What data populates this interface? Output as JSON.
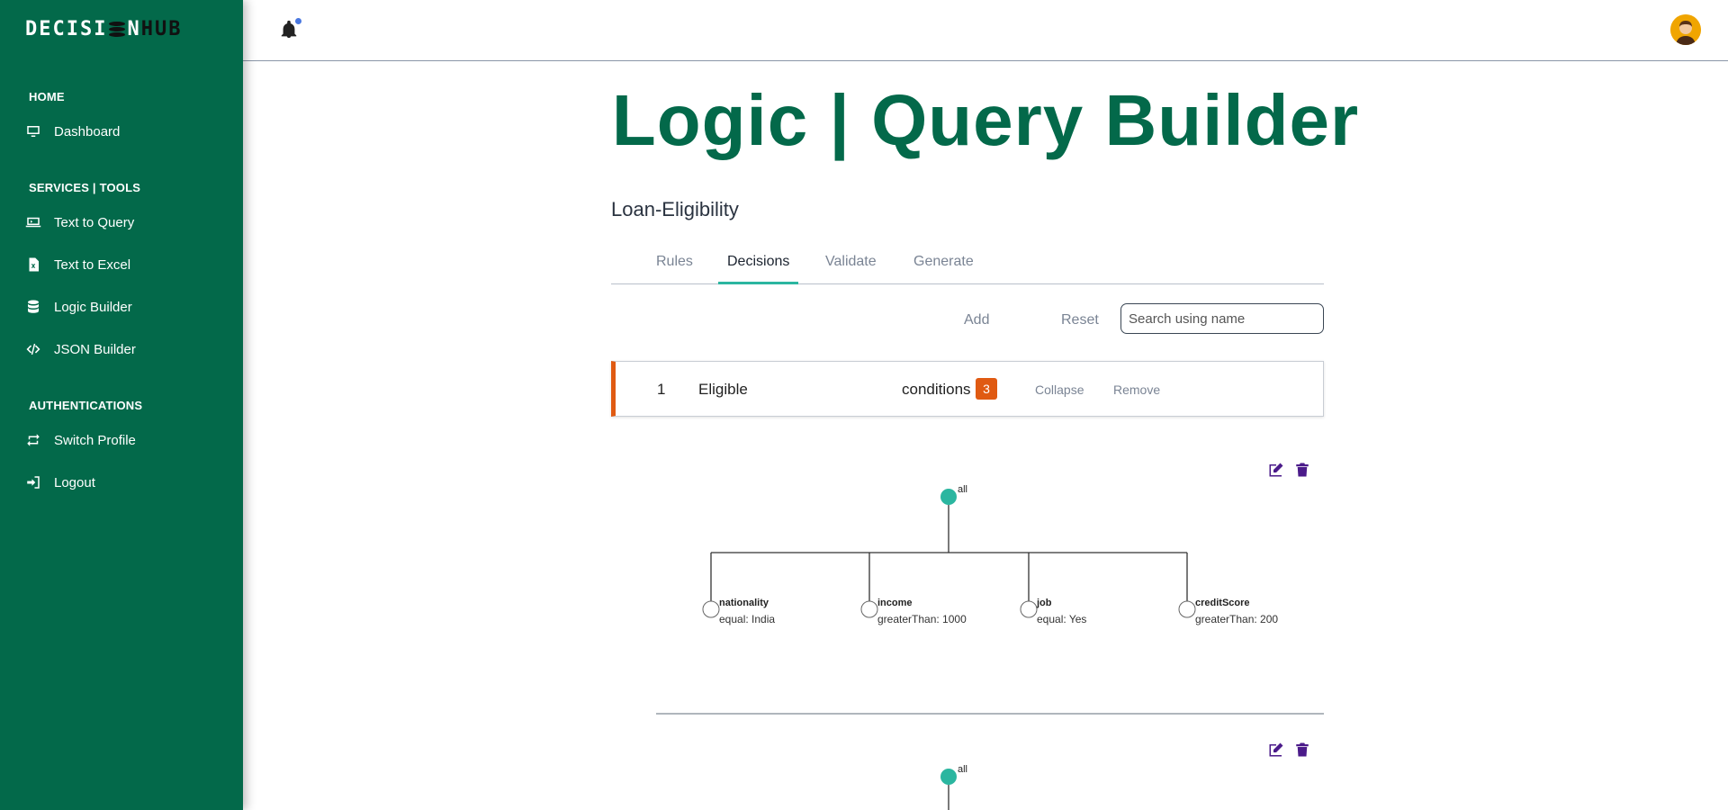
{
  "brand": {
    "name_part1": "DECISI",
    "name_part2": "N",
    "name_part3": "HUB"
  },
  "sidebar": {
    "sections": [
      {
        "title": "HOME"
      },
      {
        "title": "SERVICES | TOOLS"
      },
      {
        "title": "AUTHENTICATIONS"
      }
    ],
    "items": [
      {
        "label": "Dashboard",
        "icon": "monitor-icon"
      },
      {
        "label": "Text to Query",
        "icon": "terminal-icon"
      },
      {
        "label": "Text to Excel",
        "icon": "excel-file-icon"
      },
      {
        "label": "Logic Builder",
        "icon": "database-icon"
      },
      {
        "label": "JSON Builder",
        "icon": "code-icon"
      },
      {
        "label": "Switch Profile",
        "icon": "switch-icon"
      },
      {
        "label": "Logout",
        "icon": "logout-icon"
      }
    ]
  },
  "header": {
    "notification_icon": "bell-icon",
    "has_notification": true
  },
  "page": {
    "title": "Logic | Query Builder",
    "rule_name": "Loan-Eligibility",
    "tabs": [
      {
        "label": "Rules",
        "active": false
      },
      {
        "label": "Decisions",
        "active": true
      },
      {
        "label": "Validate",
        "active": false
      },
      {
        "label": "Generate",
        "active": false
      }
    ],
    "actions": {
      "add_label": "Add",
      "reset_label": "Reset",
      "search_placeholder": "Search using name"
    }
  },
  "decision": {
    "index": "1",
    "name": "Eligible",
    "conditions_label": "conditions",
    "conditions_count": "3",
    "collapse_label": "Collapse",
    "remove_label": "Remove"
  },
  "trees": [
    {
      "root": "all",
      "children": [
        {
          "fact": "nationality",
          "condition": "equal: India"
        },
        {
          "fact": "income",
          "condition": "greaterThan: 1000"
        },
        {
          "fact": "job",
          "condition": "equal: Yes"
        },
        {
          "fact": "creditScore",
          "condition": "greaterThan: 200"
        }
      ]
    },
    {
      "root": "all",
      "children": []
    }
  ],
  "colors": {
    "brand_green": "#03694a",
    "accent_orange": "#e05a12",
    "node_teal": "#2bb6a0",
    "icon_purple": "#4b1b8a"
  }
}
